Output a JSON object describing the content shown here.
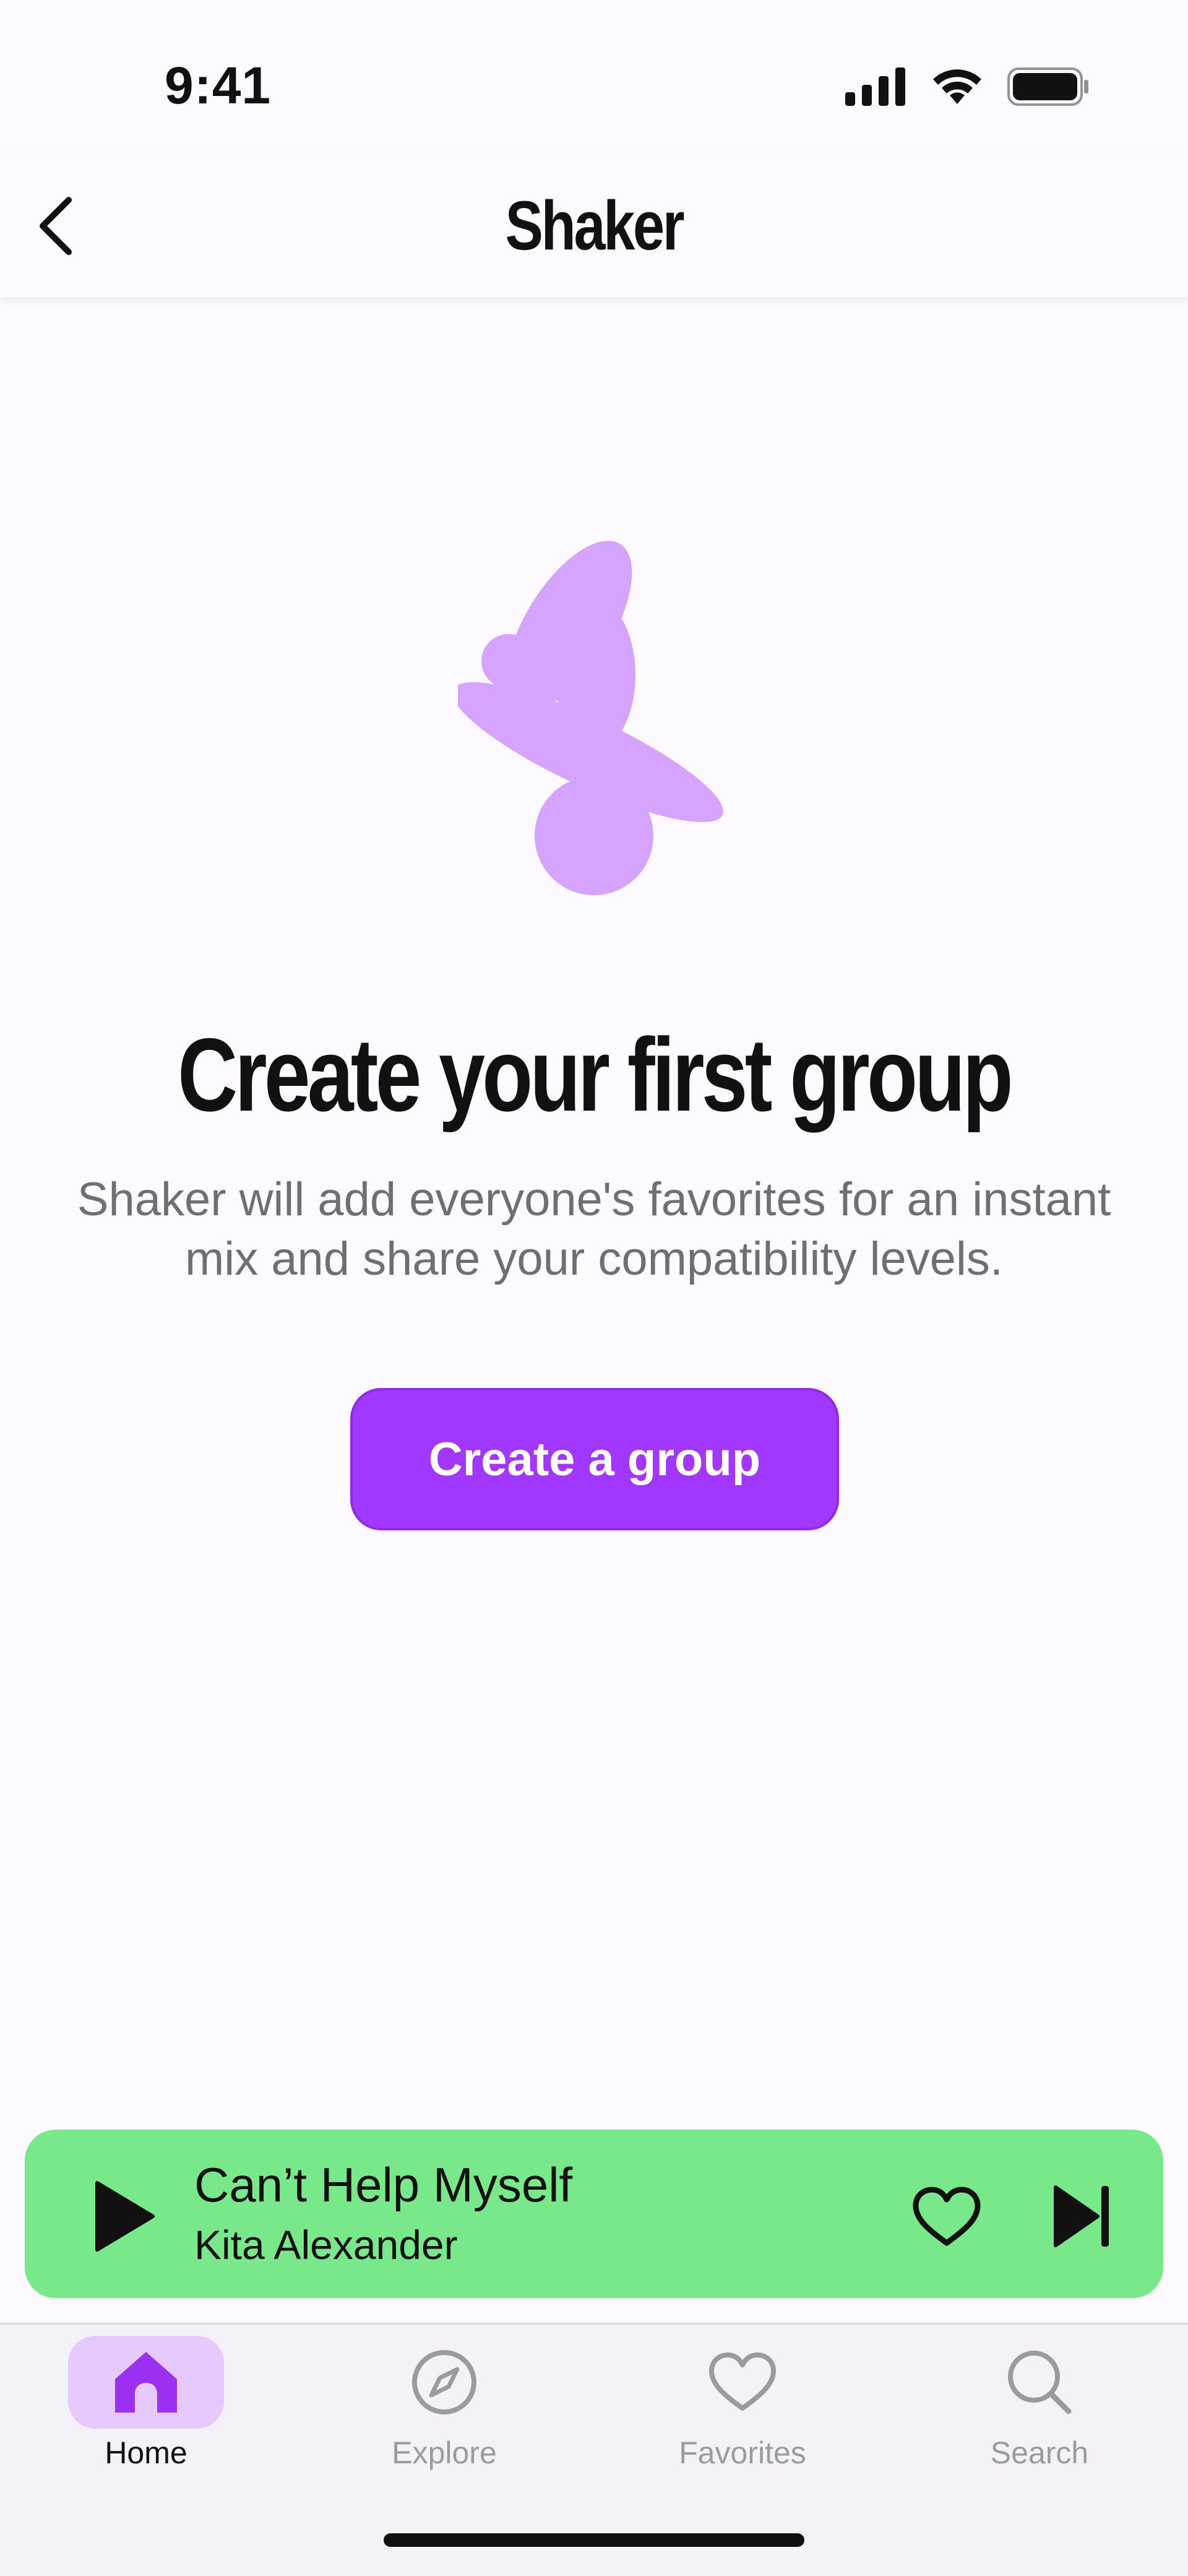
{
  "status_bar": {
    "time": "9:41"
  },
  "nav": {
    "title": "Shaker"
  },
  "empty_state": {
    "headline": "Create your first group",
    "description": "Shaker will add everyone's favorites for an instant mix and share your compatibility levels.",
    "cta_label": "Create a group"
  },
  "player": {
    "song_title": "Can’t Help Myself",
    "artist": "Kita Alexander"
  },
  "tabs": [
    {
      "label": "Home",
      "icon": "home-icon",
      "active": true
    },
    {
      "label": "Explore",
      "icon": "compass-icon",
      "active": false
    },
    {
      "label": "Favorites",
      "icon": "heart-icon",
      "active": false
    },
    {
      "label": "Search",
      "icon": "search-icon",
      "active": false
    }
  ],
  "colors": {
    "accent": "#a237ff",
    "illustration": "#d6a4ff",
    "player_bg": "#78e88a",
    "tab_active_bg": "#e6c9ff",
    "background": "#fcfaff"
  }
}
